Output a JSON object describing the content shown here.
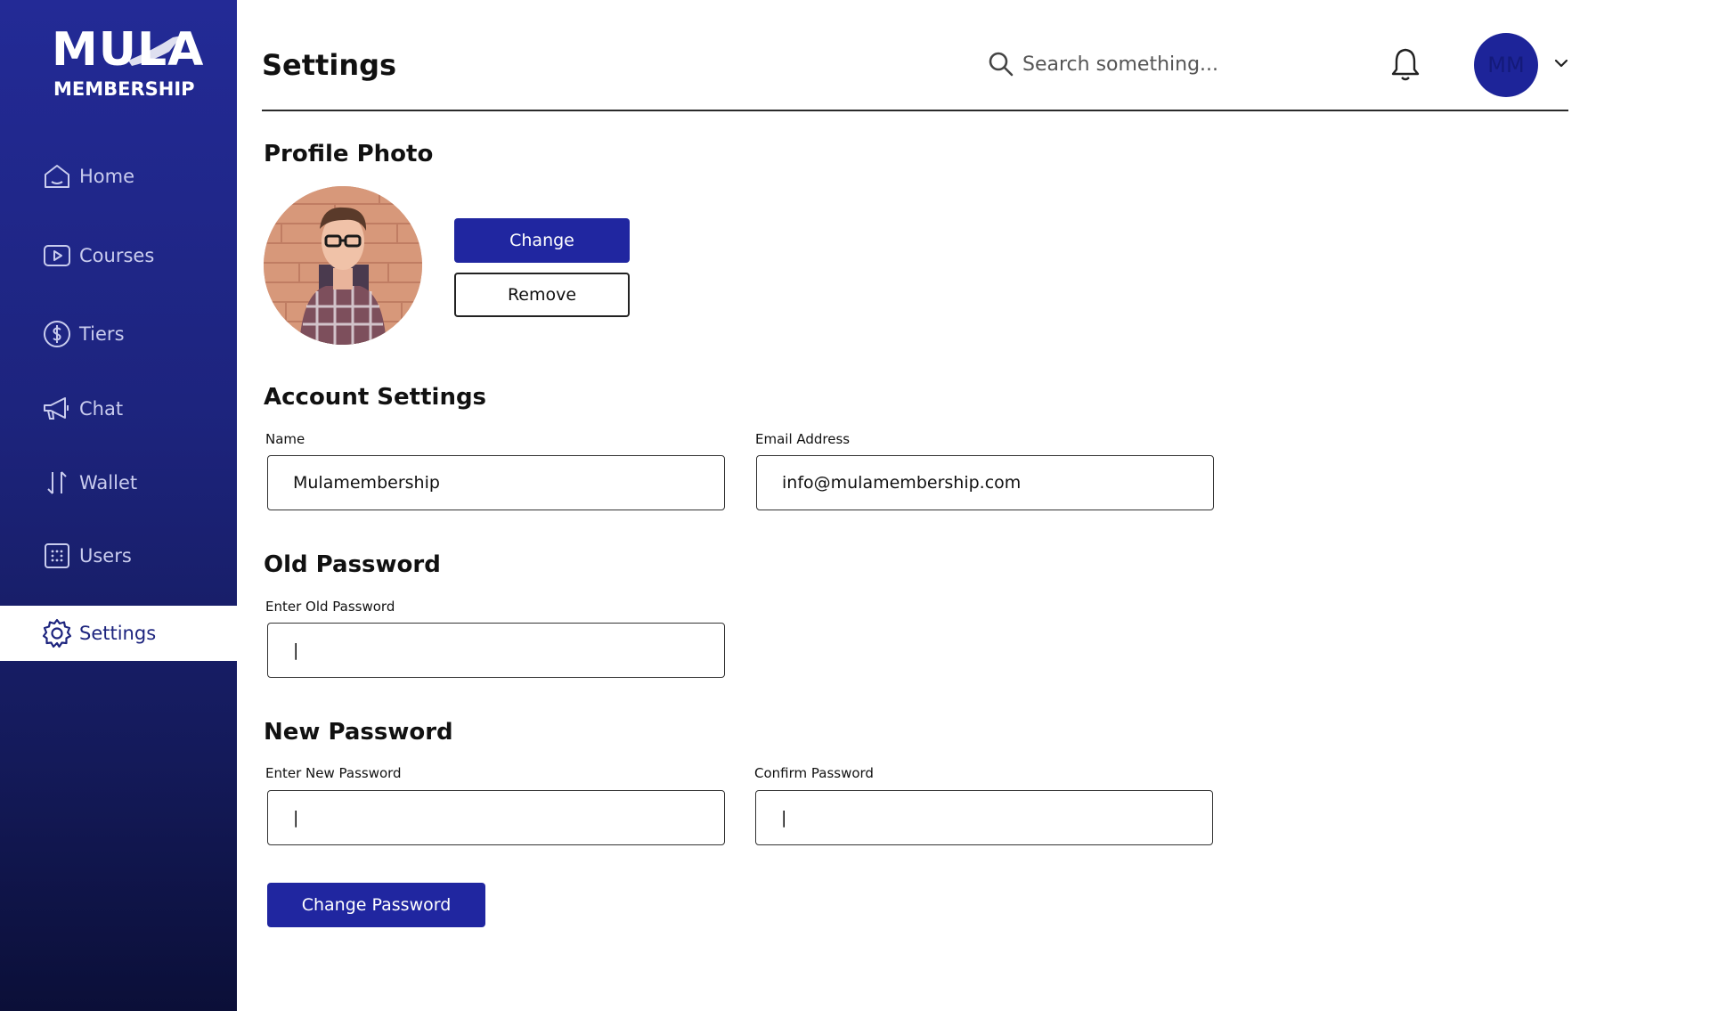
{
  "brand": {
    "logo_top": "MULA",
    "logo_bottom": "MEMBERSHIP"
  },
  "sidebar": {
    "items": [
      {
        "label": "Home",
        "icon": "home-icon",
        "active": false
      },
      {
        "label": "Courses",
        "icon": "play-icon",
        "active": false
      },
      {
        "label": "Tiers",
        "icon": "dollar-icon",
        "active": false
      },
      {
        "label": "Chat",
        "icon": "megaphone-icon",
        "active": false
      },
      {
        "label": "Wallet",
        "icon": "transfer-arrows-icon",
        "active": false
      },
      {
        "label": "Users",
        "icon": "users-grid-icon",
        "active": false
      },
      {
        "label": "Settings",
        "icon": "gear-icon",
        "active": true
      }
    ]
  },
  "header": {
    "title": "Settings",
    "search_placeholder": "Search something...",
    "avatar_initials": "MM"
  },
  "profile_photo": {
    "section_title": "Profile Photo",
    "change_label": "Change",
    "remove_label": "Remove"
  },
  "account_settings": {
    "section_title": "Account Settings",
    "name_label": "Name",
    "name_value": "Mulamembership",
    "email_label": "Email Address",
    "email_value": "info@mulamembership.com"
  },
  "old_password": {
    "section_title": "Old Password",
    "label": "Enter Old Password",
    "value": "|"
  },
  "new_password": {
    "section_title": "New Password",
    "new_label": "Enter New Password",
    "new_value": "|",
    "confirm_label": "Confirm Password",
    "confirm_value": "|",
    "submit_label": "Change Password"
  },
  "colors": {
    "sidebar_top": "#232a96",
    "sidebar_bottom": "#0b0f38",
    "primary": "#2026a0",
    "active_nav_text": "#1d247e"
  }
}
